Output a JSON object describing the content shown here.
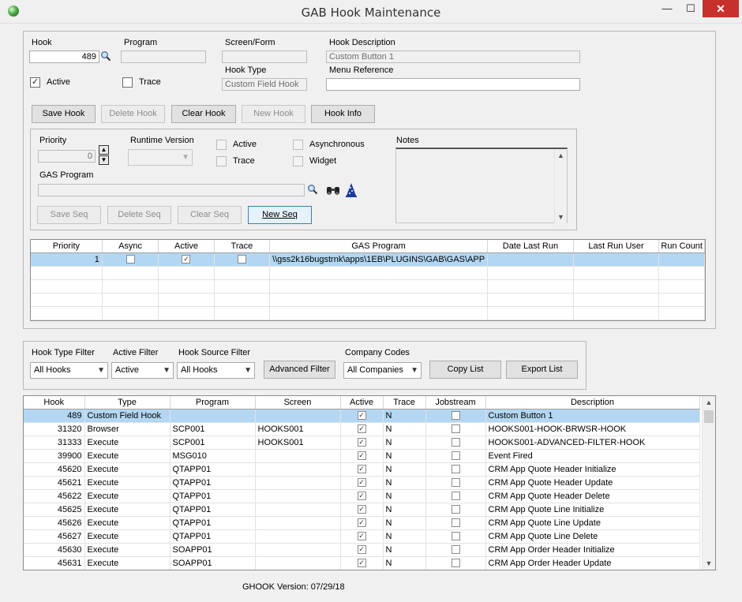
{
  "window": {
    "title": "GAB Hook Maintenance",
    "min": "—",
    "max": "☐",
    "close": "✕"
  },
  "hook": {
    "hook_label": "Hook",
    "hook_value": "489",
    "program_label": "Program",
    "program_value": "",
    "screen_label": "Screen/Form",
    "screen_value": "",
    "desc_label": "Hook Description",
    "desc_value": "Custom Button 1",
    "active_label": "Active",
    "active_checked": "✓",
    "trace_label": "Trace",
    "trace_checked": "",
    "type_label": "Hook Type",
    "type_value": "Custom Field Hook",
    "menu_label": "Menu Reference",
    "menu_value": ""
  },
  "hook_buttons": {
    "save": "Save Hook",
    "delete": "Delete Hook",
    "clear": "Clear Hook",
    "new": "New Hook",
    "info": "Hook Info"
  },
  "seq": {
    "priority_label": "Priority",
    "priority_value": "0",
    "runtime_label": "Runtime Version",
    "runtime_value": "",
    "active_label": "Active",
    "trace_label": "Trace",
    "async_label": "Asynchronous",
    "widget_label": "Widget",
    "notes_label": "Notes",
    "gas_label": "GAS Program",
    "gas_value": ""
  },
  "seq_buttons": {
    "save": "Save Seq",
    "delete": "Delete Seq",
    "clear": "Clear Seq",
    "new": "New Seq"
  },
  "seq_grid": {
    "columns": [
      "Priority",
      "Async",
      "Active",
      "Trace",
      "GAS Program",
      "Date Last Run",
      "Last Run User",
      "Run Count"
    ],
    "rows": [
      {
        "priority": "1",
        "async": "",
        "active": "✓",
        "trace": "",
        "gas": "\\\\gss2k16bugstrnk\\apps\\1EB\\PLUGINS\\GAB\\GAS\\APP",
        "date": "",
        "user": "",
        "count": ""
      }
    ]
  },
  "filters": {
    "type_label": "Hook Type Filter",
    "type_value": "All Hooks",
    "active_label": "Active Filter",
    "active_value": "Active",
    "source_label": "Hook Source Filter",
    "source_value": "All Hooks",
    "advanced": "Advanced Filter",
    "company_label": "Company Codes",
    "company_value": "All Companies",
    "copy": "Copy List",
    "export": "Export List"
  },
  "hooks_grid": {
    "columns": [
      "Hook",
      "Type",
      "Program",
      "Screen",
      "Active",
      "Trace",
      "Jobstream",
      "Description"
    ],
    "rows": [
      {
        "hook": "489",
        "type": "Custom Field Hook",
        "program": "",
        "screen": "",
        "active": "✓",
        "trace": "N",
        "job": "",
        "desc": "Custom Button 1"
      },
      {
        "hook": "31320",
        "type": "Browser",
        "program": "SCP001",
        "screen": "HOOKS001",
        "active": "✓",
        "trace": "N",
        "job": "",
        "desc": "HOOKS001-HOOK-BRWSR-HOOK"
      },
      {
        "hook": "31333",
        "type": "Execute",
        "program": "SCP001",
        "screen": "HOOKS001",
        "active": "✓",
        "trace": "N",
        "job": "",
        "desc": "HOOKS001-ADVANCED-FILTER-HOOK"
      },
      {
        "hook": "39900",
        "type": "Execute",
        "program": "MSG010",
        "screen": "",
        "active": "✓",
        "trace": "N",
        "job": "",
        "desc": "Event Fired"
      },
      {
        "hook": "45620",
        "type": "Execute",
        "program": "QTAPP01",
        "screen": "",
        "active": "✓",
        "trace": "N",
        "job": "",
        "desc": "CRM App Quote Header Initialize"
      },
      {
        "hook": "45621",
        "type": "Execute",
        "program": "QTAPP01",
        "screen": "",
        "active": "✓",
        "trace": "N",
        "job": "",
        "desc": "CRM App Quote Header Update"
      },
      {
        "hook": "45622",
        "type": "Execute",
        "program": "QTAPP01",
        "screen": "",
        "active": "✓",
        "trace": "N",
        "job": "",
        "desc": "CRM App Quote Header Delete"
      },
      {
        "hook": "45625",
        "type": "Execute",
        "program": "QTAPP01",
        "screen": "",
        "active": "✓",
        "trace": "N",
        "job": "",
        "desc": "CRM App Quote Line Initialize"
      },
      {
        "hook": "45626",
        "type": "Execute",
        "program": "QTAPP01",
        "screen": "",
        "active": "✓",
        "trace": "N",
        "job": "",
        "desc": "CRM App Quote Line Update"
      },
      {
        "hook": "45627",
        "type": "Execute",
        "program": "QTAPP01",
        "screen": "",
        "active": "✓",
        "trace": "N",
        "job": "",
        "desc": "CRM App Quote Line Delete"
      },
      {
        "hook": "45630",
        "type": "Execute",
        "program": "SOAPP01",
        "screen": "",
        "active": "✓",
        "trace": "N",
        "job": "",
        "desc": "CRM App Order Header Initialize"
      },
      {
        "hook": "45631",
        "type": "Execute",
        "program": "SOAPP01",
        "screen": "",
        "active": "✓",
        "trace": "N",
        "job": "",
        "desc": "CRM App Order Header Update"
      }
    ]
  },
  "footer": {
    "version": "GHOOK Version: 07/29/18"
  },
  "icons": {
    "search": "search-icon",
    "binoculars": "binoculars-icon",
    "wizard": "wizard-icon"
  },
  "colors": {
    "selection": "#b3d7f2",
    "close_button": "#c7302b",
    "focus_border": "#3c7fb1"
  }
}
